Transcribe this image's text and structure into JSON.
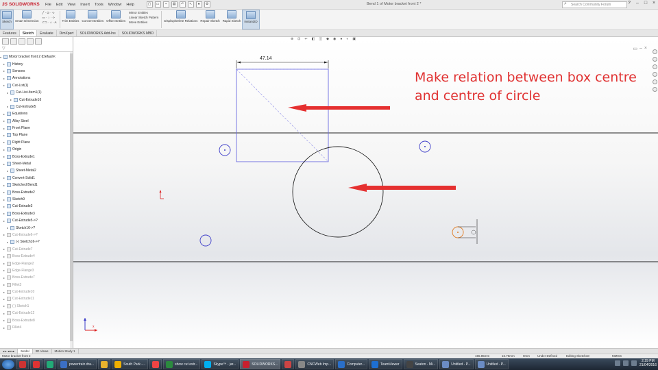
{
  "app": {
    "logo_text": "SOLIDWORKS",
    "logo_prefix": "3S",
    "document_title": "Bend 1 of Motor bracket front 2 *",
    "menu": [
      "File",
      "Edit",
      "View",
      "Insert",
      "Tools",
      "Window",
      "Help"
    ],
    "search_placeholder": "Search Community Forum",
    "window_controls": [
      "?",
      "–",
      "□",
      "×"
    ]
  },
  "command_manager": {
    "sketch_label": "Sketch",
    "smart_dimension_label": "Smart Dimension",
    "trim_entities_label": "Trim Entities",
    "convert_entities_label": "Convert Entities",
    "offset_entities_label": "Offset Entities",
    "mirror_entities_label": "Mirror Entities",
    "linear_pattern_label": "Linear Sketch Pattern",
    "move_entities_label": "Move Entities",
    "display_relations_label": "Display/Delete Relations",
    "repair_sketch_label": "Repair Sketch",
    "rapid_sketch_label": "Rapid Sketch",
    "instant2d_label": "Instant2D"
  },
  "tabs": [
    "Features",
    "Sketch",
    "Evaluate",
    "DimXpert",
    "SOLIDWORKS Add-Ins",
    "SOLIDWORKS MBD"
  ],
  "active_tab": "Sketch",
  "tree": {
    "root": "Motor bracket front 2 (Default<",
    "items": [
      {
        "label": "History",
        "depth": 1,
        "grey": false
      },
      {
        "label": "Sensors",
        "depth": 1,
        "grey": false
      },
      {
        "label": "Annotations",
        "depth": 1,
        "grey": false
      },
      {
        "label": "Cut-List(1)",
        "depth": 1,
        "grey": false
      },
      {
        "label": "Cut-List-Item1(1)",
        "depth": 2,
        "grey": false
      },
      {
        "label": "Cut-Extrude16",
        "depth": 3,
        "grey": false
      },
      {
        "label": "Cut-Extrude5",
        "depth": 2,
        "grey": false
      },
      {
        "label": "Equations",
        "depth": 1,
        "grey": false
      },
      {
        "label": "Alloy Steel",
        "depth": 1,
        "grey": false
      },
      {
        "label": "Front Plane",
        "depth": 1,
        "grey": false
      },
      {
        "label": "Top Plane",
        "depth": 1,
        "grey": false
      },
      {
        "label": "Right Plane",
        "depth": 1,
        "grey": false
      },
      {
        "label": "Origin",
        "depth": 1,
        "grey": false
      },
      {
        "label": "Boss-Extrude1",
        "depth": 1,
        "grey": false
      },
      {
        "label": "Sheet-Metal",
        "depth": 1,
        "grey": false
      },
      {
        "label": "Sheet-Metal2",
        "depth": 2,
        "grey": false
      },
      {
        "label": "Convert-Solid1",
        "depth": 1,
        "grey": false
      },
      {
        "label": "Sketched Bend1",
        "depth": 1,
        "grey": false
      },
      {
        "label": "Boss-Extrude2",
        "depth": 1,
        "grey": false
      },
      {
        "label": "Sketch9",
        "depth": 1,
        "grey": false
      },
      {
        "label": "Cut-Extrude3",
        "depth": 1,
        "grey": false
      },
      {
        "label": "Boss-Extrude3",
        "depth": 1,
        "grey": false
      },
      {
        "label": "Cut-Extrude5->?",
        "depth": 1,
        "grey": false
      },
      {
        "label": "Sketch16->?",
        "depth": 2,
        "grey": false
      },
      {
        "label": "Cut-Extrude6->?",
        "depth": 1,
        "grey": true
      },
      {
        "label": "(-) Sketch16->?",
        "depth": 2,
        "grey": false
      },
      {
        "label": "Cut-Extrude7",
        "depth": 1,
        "grey": true
      },
      {
        "label": "Boss-Extrude4",
        "depth": 1,
        "grey": true
      },
      {
        "label": "Edge-Flange2",
        "depth": 1,
        "grey": true
      },
      {
        "label": "Edge-Flange3",
        "depth": 1,
        "grey": true
      },
      {
        "label": "Boss-Extrude7",
        "depth": 1,
        "grey": true
      },
      {
        "label": "Fillet3",
        "depth": 1,
        "grey": true
      },
      {
        "label": "Cut-Extrude10",
        "depth": 1,
        "grey": true
      },
      {
        "label": "Cut-Extrude11",
        "depth": 1,
        "grey": true
      },
      {
        "label": "(-) Sketch1",
        "depth": 1,
        "grey": true
      },
      {
        "label": "Cut-Extrude12",
        "depth": 1,
        "grey": true
      },
      {
        "label": "Boss-Extrude8",
        "depth": 1,
        "grey": true
      },
      {
        "label": "Fillet4",
        "depth": 1,
        "grey": true
      }
    ]
  },
  "graphics": {
    "dimension_value": "47.14",
    "annotation_line1": "Make relation between box centre",
    "annotation_line2": "and centre of circle",
    "annotation_color": "#e03333",
    "sketch_color": "#5a5ad0",
    "arrow_color": "#e53030"
  },
  "model_tabs": [
    "Model",
    "3D Views",
    "Motion Study 1"
  ],
  "active_model_tab": "Model",
  "status": {
    "file": "Motor bracket front 2",
    "x": "155.85mm",
    "y": "16.75mm",
    "z": "0mm",
    "state": "Under Defined",
    "mode": "Editing Sketch18",
    "units": "MMGS"
  },
  "taskbar": {
    "items": [
      {
        "label": "",
        "color": "#c33"
      },
      {
        "label": "",
        "color": "#d33"
      },
      {
        "label": "",
        "color": "#2a7"
      },
      {
        "label": "powertrain dra...",
        "color": "#3b6fc4"
      },
      {
        "label": "",
        "color": "#e8b32d"
      },
      {
        "label": "South Park -...",
        "color": "#f0b000"
      },
      {
        "label": "",
        "color": "#e44"
      },
      {
        "label": "show cut extr...",
        "color": "#2b8a3e"
      },
      {
        "label": "Skype™ - jar...",
        "color": "#00aff0"
      },
      {
        "label": "SOLIDWORKS...",
        "color": "#c8202e"
      },
      {
        "label": "",
        "color": "#c44"
      },
      {
        "label": "CNCWeb Imp...",
        "color": "#888"
      },
      {
        "label": "Computer...",
        "color": "#2a6fc9"
      },
      {
        "label": "TeamViewer",
        "color": "#1d6fd1"
      },
      {
        "label": "Seaton - Mi...",
        "color": "#444"
      },
      {
        "label": "Untitled - P...",
        "color": "#6b8cc4"
      },
      {
        "label": "Untitled - P...",
        "color": "#6b8cc4"
      }
    ],
    "time": "2:29 PM",
    "date": "21/04/2016"
  }
}
